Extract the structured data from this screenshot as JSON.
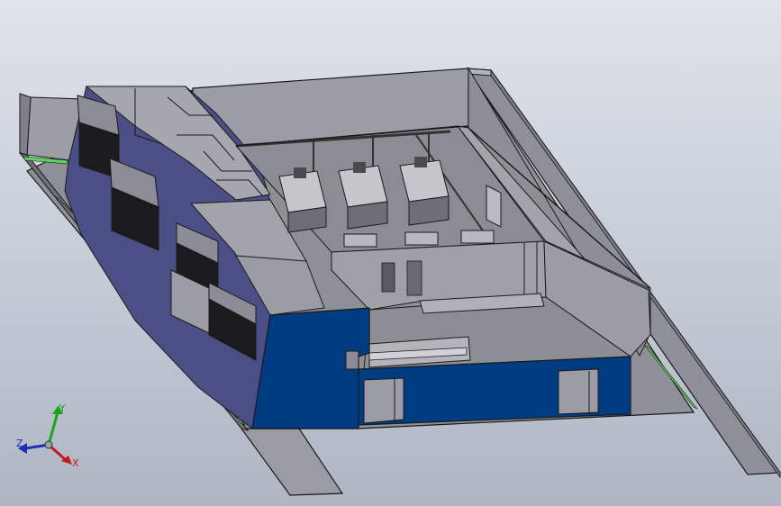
{
  "viewport": {
    "background_top": "#dfe3ea",
    "background_bottom": "#aeb6c3"
  },
  "model": {
    "wall_color": "#9a9aa4",
    "floor_color": "#8f8f98",
    "accent_wall_color": "#003c82",
    "side_wall_color": "#4c4f86",
    "highlight_strip_color": "#5fd35f"
  },
  "triad": {
    "y_label": "Y",
    "z_label": "Z",
    "x_label": "X",
    "y_color": "#1aa51a",
    "z_color": "#1c2fb8",
    "x_color": "#c41a1a"
  }
}
